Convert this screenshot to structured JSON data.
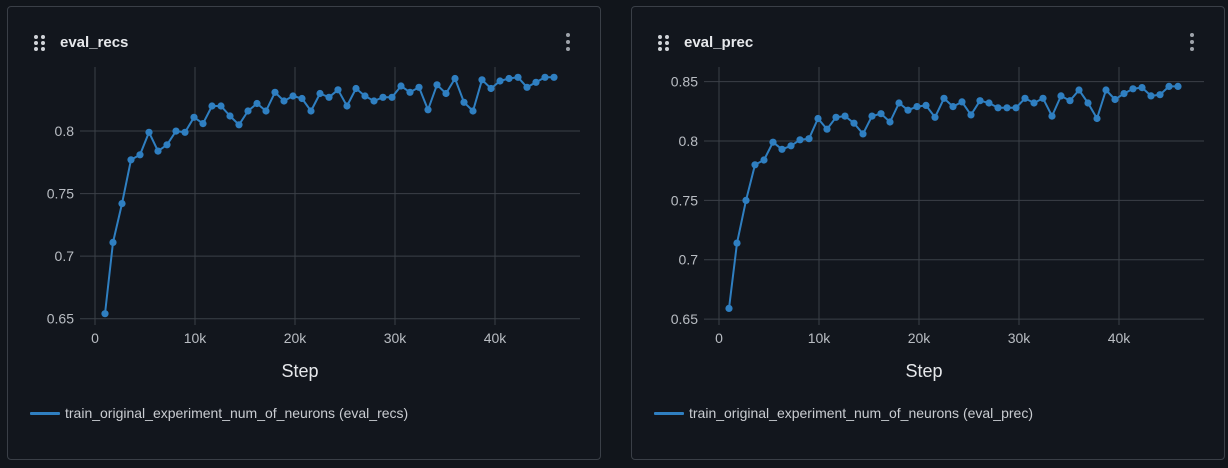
{
  "colors": {
    "background": "#11151b",
    "panel_border": "#3a3f47",
    "series": "#2f7fc1",
    "grid": "#3b4048",
    "text": "#e6e8eb",
    "muted_text": "#b9bdc3"
  },
  "icons": {
    "drag": "drag-handle-icon",
    "menu": "more-vertical-icon"
  },
  "panels": [
    {
      "title": "eval_recs",
      "legend_label": "train_original_experiment_num_of_neurons (eval_recs)"
    },
    {
      "title": "eval_prec",
      "legend_label": "train_original_experiment_num_of_neurons (eval_prec)"
    }
  ],
  "chart_data": [
    {
      "type": "line",
      "title": "eval_recs",
      "xlabel": "Step",
      "ylabel": "",
      "xlim": [
        -1500,
        48500
      ],
      "ylim": [
        0.645,
        0.848
      ],
      "xticks": [
        0,
        10000,
        20000,
        30000,
        40000
      ],
      "xtick_labels": [
        "0",
        "10k",
        "20k",
        "30k",
        "40k"
      ],
      "yticks": [
        0.65,
        0.7,
        0.75,
        0.8
      ],
      "ytick_labels": [
        "0.65",
        "0.7",
        "0.75",
        "0.8"
      ],
      "grid": true,
      "legend": "bottom",
      "series": [
        {
          "name": "train_original_experiment_num_of_neurons (eval_recs)",
          "color": "#2f7fc1",
          "x": [
            1000,
            1800,
            2700,
            3600,
            4500,
            5400,
            6300,
            7200,
            8100,
            9000,
            9900,
            10800,
            11700,
            12600,
            13500,
            14400,
            15300,
            16200,
            17100,
            18000,
            18900,
            19800,
            20700,
            21600,
            22500,
            23400,
            24300,
            25200,
            26100,
            27000,
            27900,
            28800,
            29700,
            30600,
            31500,
            32400,
            33300,
            34200,
            35100,
            36000,
            36900,
            37800,
            38700,
            39600,
            40500,
            41400,
            42300,
            43200,
            44100,
            45000,
            45900
          ],
          "y": [
            0.654,
            0.711,
            0.742,
            0.777,
            0.781,
            0.799,
            0.784,
            0.789,
            0.8,
            0.799,
            0.811,
            0.806,
            0.82,
            0.82,
            0.812,
            0.805,
            0.816,
            0.822,
            0.816,
            0.831,
            0.824,
            0.828,
            0.826,
            0.816,
            0.83,
            0.827,
            0.833,
            0.82,
            0.834,
            0.828,
            0.824,
            0.827,
            0.827,
            0.836,
            0.831,
            0.835,
            0.817,
            0.837,
            0.83,
            0.842,
            0.823,
            0.816,
            0.841,
            0.834,
            0.84,
            0.842,
            0.843,
            0.835,
            0.839,
            0.843,
            0.843
          ]
        }
      ]
    },
    {
      "type": "line",
      "title": "eval_prec",
      "xlabel": "Step",
      "ylabel": "",
      "xlim": [
        -1500,
        48500
      ],
      "ylim": [
        0.645,
        0.859
      ],
      "xticks": [
        0,
        10000,
        20000,
        30000,
        40000
      ],
      "xtick_labels": [
        "0",
        "10k",
        "20k",
        "30k",
        "40k"
      ],
      "yticks": [
        0.65,
        0.7,
        0.75,
        0.8,
        0.85
      ],
      "ytick_labels": [
        "0.65",
        "0.7",
        "0.75",
        "0.8",
        "0.85"
      ],
      "grid": true,
      "legend": "bottom",
      "series": [
        {
          "name": "train_original_experiment_num_of_neurons (eval_prec)",
          "color": "#2f7fc1",
          "x": [
            1000,
            1800,
            2700,
            3600,
            4500,
            5400,
            6300,
            7200,
            8100,
            9000,
            9900,
            10800,
            11700,
            12600,
            13500,
            14400,
            15300,
            16200,
            17100,
            18000,
            18900,
            19800,
            20700,
            21600,
            22500,
            23400,
            24300,
            25200,
            26100,
            27000,
            27900,
            28800,
            29700,
            30600,
            31500,
            32400,
            33300,
            34200,
            35100,
            36000,
            36900,
            37800,
            38700,
            39600,
            40500,
            41400,
            42300,
            43200,
            44100,
            45000,
            45900
          ],
          "y": [
            0.659,
            0.714,
            0.75,
            0.78,
            0.784,
            0.799,
            0.793,
            0.796,
            0.801,
            0.802,
            0.819,
            0.81,
            0.82,
            0.821,
            0.815,
            0.806,
            0.821,
            0.823,
            0.816,
            0.832,
            0.826,
            0.829,
            0.83,
            0.82,
            0.836,
            0.829,
            0.833,
            0.822,
            0.834,
            0.832,
            0.828,
            0.828,
            0.828,
            0.836,
            0.832,
            0.836,
            0.821,
            0.838,
            0.834,
            0.843,
            0.832,
            0.819,
            0.843,
            0.835,
            0.84,
            0.844,
            0.845,
            0.838,
            0.839,
            0.846,
            0.846
          ]
        }
      ]
    }
  ]
}
